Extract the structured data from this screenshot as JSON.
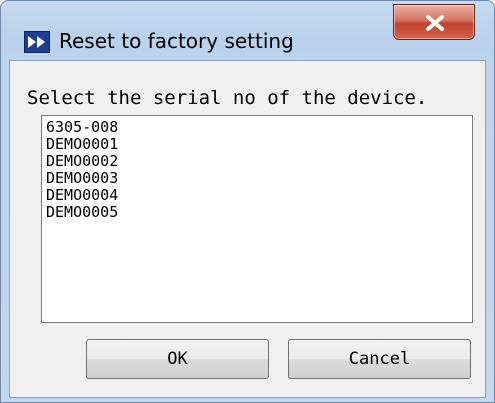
{
  "window": {
    "title": "Reset to factory setting",
    "icon": "app-logo-icon",
    "close_icon": "close-icon"
  },
  "dialog": {
    "prompt": "Select the serial no of the device.",
    "serials": [
      "6305-008",
      "DEMO0001",
      "DEMO0002",
      "DEMO0003",
      "DEMO0004",
      "DEMO0005"
    ],
    "ok_label": "OK",
    "cancel_label": "Cancel"
  },
  "colors": {
    "title_bar": "#bdd4ed",
    "close_button": "#c2412a",
    "client_bg": "#f0f0f0",
    "icon_bg": "#1e3e8f"
  }
}
